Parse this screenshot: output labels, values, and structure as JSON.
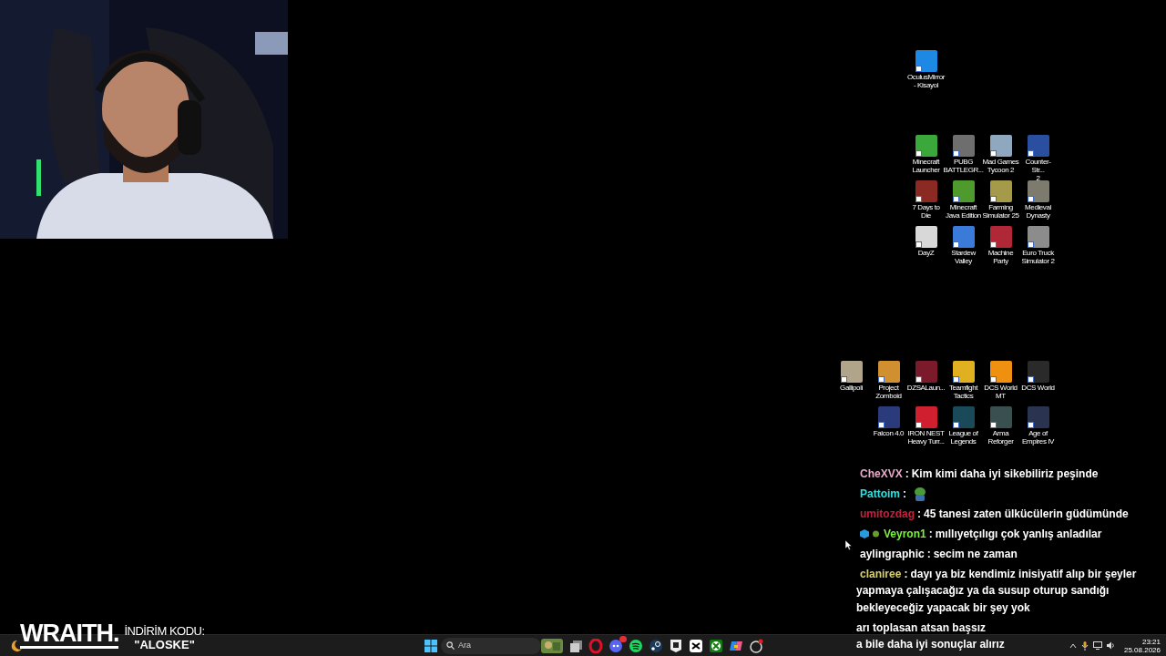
{
  "desktop_icon_rows": [
    {
      "icons": [
        {
          "label": "OculusMirror\n- Kisayol",
          "color": "#1e88e5"
        }
      ]
    },
    {
      "icons": [
        {
          "label": "Minecraft\nLauncher",
          "color": "#3aa83a"
        },
        {
          "label": "PUBG\nBATTLEGR...",
          "color": "#6e6e6e"
        },
        {
          "label": "Mad Games\nTycoon 2",
          "color": "#8fa8c0"
        },
        {
          "label": "Counter-Str...\n2",
          "color": "#2a4fa0"
        }
      ]
    },
    {
      "icons": [
        {
          "label": "7 Days to Die",
          "color": "#8a2a22"
        },
        {
          "label": "Minecraft\nJava Edition",
          "color": "#4f9a2c"
        },
        {
          "label": "Farming\nSimulator 25",
          "color": "#a49a4a"
        },
        {
          "label": "Medieval\nDynasty",
          "color": "#7d7a6e"
        }
      ]
    },
    {
      "icons": [
        {
          "label": "DayZ",
          "color": "#d8d8d8"
        },
        {
          "label": "Stardew\nValley",
          "color": "#3a7ad8"
        },
        {
          "label": "Machine\nParty",
          "color": "#b02838"
        },
        {
          "label": "Euro Truck\nSimulator 2",
          "color": "#8c8c8c"
        }
      ]
    },
    {
      "icons": [
        {
          "label": "Gallipoli",
          "color": "#b0a48a"
        },
        {
          "label": "Project\nZomboid",
          "color": "#d09030"
        },
        {
          "label": "DZSALaun...",
          "color": "#7a1a2a"
        },
        {
          "label": "Teamfight\nTactics",
          "color": "#e0b020"
        },
        {
          "label": "DCS World\nMT",
          "color": "#f09010"
        },
        {
          "label": "DCS World",
          "color": "#2a2a2a"
        }
      ]
    },
    {
      "icons": [
        {
          "label": "Falcon 4.0",
          "color": "#2a3a7a"
        },
        {
          "label": "IRON NEST\nHeavy Turr...",
          "color": "#d02030"
        },
        {
          "label": "League of\nLegends",
          "color": "#1a4a5a"
        },
        {
          "label": "Arma\nReforger",
          "color": "#3a5050"
        },
        {
          "label": "Age of\nEmpires IV",
          "color": "#2a3450"
        }
      ]
    }
  ],
  "chat": {
    "separator": ":",
    "messages": [
      {
        "kind": "text",
        "user": "CheXVX",
        "color": "#e8a8c8",
        "text": "Kim kimi daha iyi sikebiliriz peşinde"
      },
      {
        "kind": "emote",
        "user": "Pattoim",
        "color": "#30e0e0"
      },
      {
        "kind": "text",
        "user": "umitozdag",
        "color": "#c8203c",
        "text": "45 tanesi zaten ülkücülerin güdümünde"
      },
      {
        "kind": "text",
        "user": "Veyron1",
        "color": "#80f040",
        "badges": true,
        "text": "mıllıyetçılıgı çok yanlış anladılar"
      },
      {
        "kind": "text",
        "user": "aylingraphic",
        "color": "#ffffff",
        "text": "secim ne zaman"
      },
      {
        "kind": "text",
        "user": "claniree",
        "color": "#d8d070",
        "text": "dayı ya biz kendimiz inisiyatif alıp bir şeyler",
        "continuation": [
          "yapmaya çalışacağız ya da susup oturup sandığı",
          "bekleyeceğiz yapacak bir şey yok"
        ]
      }
    ],
    "partial_lines": [
      "arı toplasan atsan başsız",
      "a bile daha iyi sonuçlar alırız"
    ]
  },
  "promo": {
    "brand": "WRAITH.",
    "label": "İNDİRİM KODU:",
    "code": "\"ALOSKE\""
  },
  "taskbar": {
    "search": {
      "placeholder": "Ara"
    },
    "apps": [
      {
        "kind": "highlight"
      },
      {
        "kind": "files"
      },
      {
        "kind": "opera"
      },
      {
        "kind": "discord"
      },
      {
        "kind": "spotify"
      },
      {
        "kind": "steam"
      },
      {
        "kind": "epic"
      },
      {
        "kind": "capcut"
      },
      {
        "kind": "xbox"
      },
      {
        "kind": "copilot"
      },
      {
        "kind": "app"
      }
    ],
    "time": "23:21",
    "date": "25.08.2026"
  }
}
